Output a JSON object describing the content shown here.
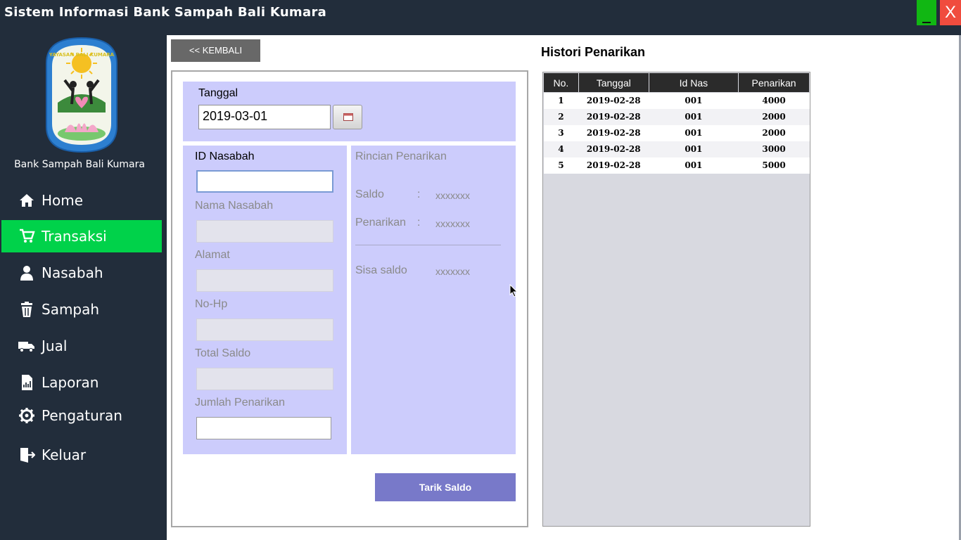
{
  "window": {
    "title": "Sistem Informasi Bank Sampah Bali Kumara",
    "minimize_label": "_",
    "close_label": "X"
  },
  "sidebar": {
    "brand": "Bank Sampah Bali Kumara",
    "logo_text": "YAYASAN BALI KUMARA",
    "items": [
      {
        "label": "Home",
        "icon": "home-icon"
      },
      {
        "label": "Transaksi",
        "icon": "cart-icon",
        "active": true
      },
      {
        "label": "Nasabah",
        "icon": "user-icon"
      },
      {
        "label": "Sampah",
        "icon": "trash-icon"
      },
      {
        "label": "Jual",
        "icon": "truck-icon"
      },
      {
        "label": "Laporan",
        "icon": "report-icon"
      },
      {
        "label": "Pengaturan",
        "icon": "gear-icon"
      },
      {
        "label": "Keluar",
        "icon": "exit-icon"
      }
    ],
    "active_color": "#00d24a"
  },
  "toolbar": {
    "back_label": "<< KEMBALI"
  },
  "form": {
    "tanggal_label": "Tanggal",
    "tanggal_value": "2019-03-01",
    "id_nasabah_label": "ID Nasabah",
    "nama_label": "Nama Nasabah",
    "alamat_label": "Alamat",
    "nohp_label": "No-Hp",
    "total_saldo_label": "Total Saldo",
    "jumlah_label": "Jumlah Penarikan",
    "submit_label": "Tarik Saldo"
  },
  "rincian": {
    "title": "Rincian Penarikan",
    "saldo_label": "Saldo",
    "saldo_value": "xxxxxxx",
    "penarikan_label": "Penarikan",
    "penarikan_value": "xxxxxxx",
    "sisa_label": "Sisa saldo",
    "sisa_value": "xxxxxxx",
    "colon": ":"
  },
  "history": {
    "title": "Histori Penarikan",
    "columns": [
      "No.",
      "Tanggal",
      "Id Nas",
      "Penarikan"
    ],
    "rows": [
      [
        "1",
        "2019-02-28",
        "001",
        "4000"
      ],
      [
        "2",
        "2019-02-28",
        "001",
        "2000"
      ],
      [
        "3",
        "2019-02-28",
        "001",
        "2000"
      ],
      [
        "4",
        "2019-02-28",
        "001",
        "3000"
      ],
      [
        "5",
        "2019-02-28",
        "001",
        "5000"
      ]
    ]
  },
  "colors": {
    "sidebar_bg": "#222d3b",
    "panel_bg": "#ccccfc",
    "button_primary": "#7879c9",
    "button_back": "#686868",
    "minimize": "#11b713",
    "close": "#f04c3e"
  }
}
